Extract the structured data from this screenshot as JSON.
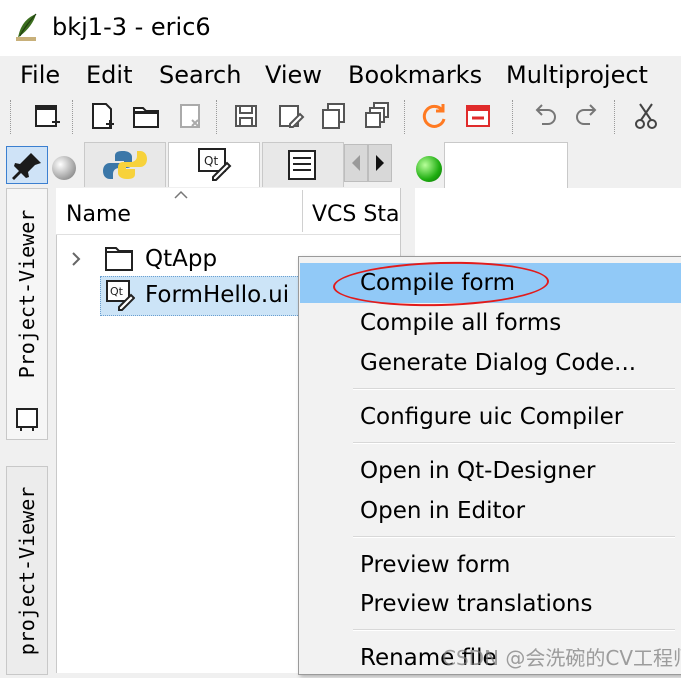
{
  "window": {
    "title": "bkj1-3 - eric6"
  },
  "menubar": {
    "items": [
      {
        "label": "File"
      },
      {
        "label": "Edit"
      },
      {
        "label": "Search"
      },
      {
        "label": "View"
      },
      {
        "label": "Bookmarks"
      },
      {
        "label": "Multiproject"
      }
    ]
  },
  "toolbar": {
    "buttons": [
      "new-window-icon",
      "new-file-icon",
      "open-folder-icon",
      "close-file-icon",
      "save-icon",
      "save-as-icon",
      "save-copy-icon",
      "save-all-icon",
      "reload-icon",
      "close-window-icon",
      "undo-icon",
      "redo-icon",
      "cut-icon"
    ]
  },
  "side_tabs": {
    "tab1": "Project-Viewer",
    "tab2": "project-Viewer"
  },
  "project_tabs": {
    "icons": [
      "python-icon",
      "qt-form-icon",
      "document-icon"
    ]
  },
  "tree": {
    "header": {
      "name": "Name",
      "vcs": "VCS Sta"
    },
    "rows": [
      {
        "label": "QtApp",
        "icon": "folder-icon"
      },
      {
        "label": "FormHello.ui",
        "icon": "qt-form-icon"
      }
    ]
  },
  "context_menu": {
    "items": [
      "Compile form",
      "Compile all forms",
      "Generate Dialog Code...",
      "Configure uic Compiler",
      "Open in Qt-Designer",
      "Open in Editor",
      "Preview form",
      "Preview translations",
      "Rename file"
    ]
  },
  "watermark": "CSDN @会洗碗的CV工程师",
  "colors": {
    "highlight": "#91c9f7",
    "selection": "#cce4f7",
    "annotation": "#e21b1b",
    "status_dot": "#1fae11"
  }
}
